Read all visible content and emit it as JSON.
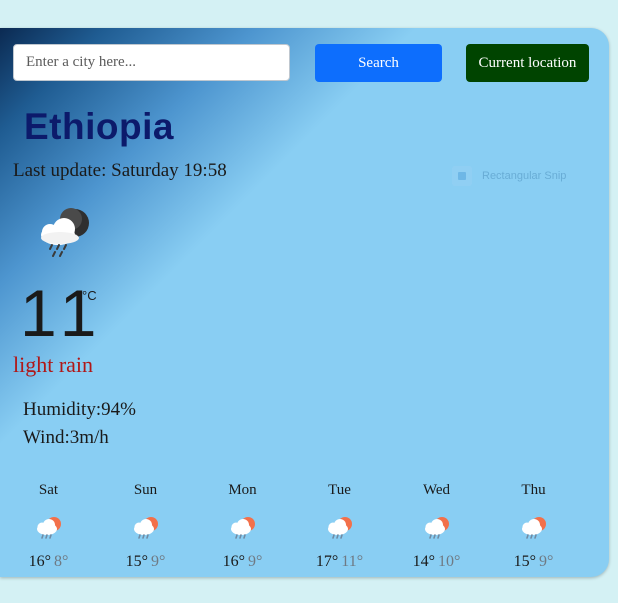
{
  "search": {
    "placeholder": "Enter a city here...",
    "button_label": "Search",
    "location_label": "Current location"
  },
  "colors": {
    "search_button": "#0d6efd",
    "location_button": "#004400",
    "city_text": "#0c1a6b",
    "description_text": "#b01717",
    "card_background": "#89cef3"
  },
  "weather": {
    "city": "Ethiopia",
    "last_update": "Last update: Saturday 19:58",
    "icon": "rain-cloud-night-icon",
    "temperature": "11",
    "unit": "°C",
    "description": "light rain",
    "humidity": "Humidity:94%",
    "wind": "Wind:3m/h"
  },
  "overlay": {
    "snip_label": "Rectangular Snip"
  },
  "forecast": [
    {
      "day": "Sat",
      "max": "16°",
      "min": "8°",
      "icon": "sun-rain-cloud-icon"
    },
    {
      "day": "Sun",
      "max": "15°",
      "min": "9°",
      "icon": "sun-rain-cloud-icon"
    },
    {
      "day": "Mon",
      "max": "16°",
      "min": "9°",
      "icon": "sun-rain-cloud-icon"
    },
    {
      "day": "Tue",
      "max": "17°",
      "min": "11°",
      "icon": "sun-rain-cloud-icon"
    },
    {
      "day": "Wed",
      "max": "14°",
      "min": "10°",
      "icon": "sun-rain-cloud-icon"
    },
    {
      "day": "Thu",
      "max": "15°",
      "min": "9°",
      "icon": "sun-rain-cloud-icon"
    }
  ]
}
